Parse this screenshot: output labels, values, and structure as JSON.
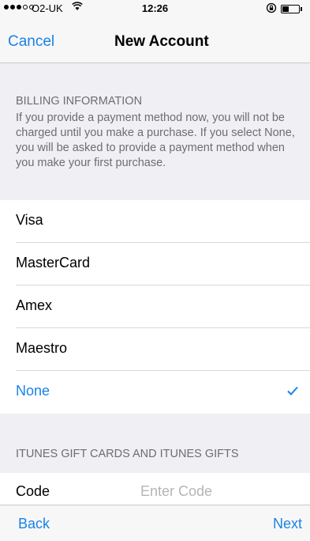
{
  "status_bar": {
    "carrier": "O2-UK",
    "time": "12:26",
    "wifi_icon": "wifi-icon",
    "lock_icon": "orientation-lock-icon",
    "battery_icon": "battery-icon",
    "battery_level": 0.35,
    "signal_strength": 3
  },
  "nav": {
    "cancel_label": "Cancel",
    "title": "New Account"
  },
  "billing": {
    "header": "BILLING INFORMATION",
    "description": "If you provide a payment method now, you will not be charged until you make a purchase. If you select None, you will be asked to provide a payment method when you make your first purchase.",
    "options": [
      {
        "label": "Visa",
        "selected": false
      },
      {
        "label": "MasterCard",
        "selected": false
      },
      {
        "label": "Amex",
        "selected": false
      },
      {
        "label": "Maestro",
        "selected": false
      },
      {
        "label": "None",
        "selected": true
      }
    ]
  },
  "gift": {
    "header": "ITUNES GIFT CARDS AND ITUNES GIFTS",
    "code_label": "Code",
    "code_value": "",
    "code_placeholder": "Enter Code"
  },
  "toolbar": {
    "back_label": "Back",
    "next_label": "Next"
  },
  "colors": {
    "accent": "#1a82e6",
    "background": "#efeff4"
  }
}
